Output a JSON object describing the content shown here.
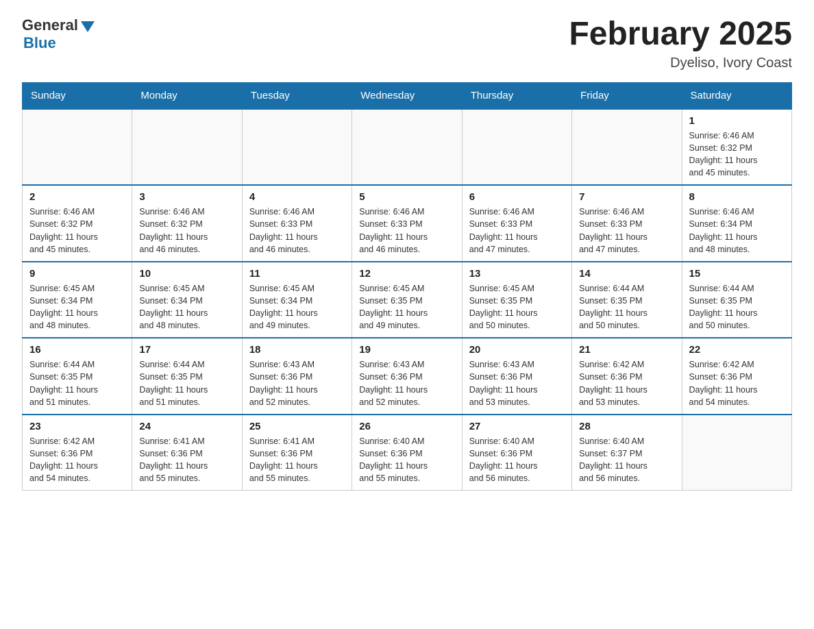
{
  "logo": {
    "general": "General",
    "blue": "Blue"
  },
  "title": "February 2025",
  "location": "Dyeliso, Ivory Coast",
  "days_of_week": [
    "Sunday",
    "Monday",
    "Tuesday",
    "Wednesday",
    "Thursday",
    "Friday",
    "Saturday"
  ],
  "weeks": [
    [
      {
        "day": "",
        "info": ""
      },
      {
        "day": "",
        "info": ""
      },
      {
        "day": "",
        "info": ""
      },
      {
        "day": "",
        "info": ""
      },
      {
        "day": "",
        "info": ""
      },
      {
        "day": "",
        "info": ""
      },
      {
        "day": "1",
        "info": "Sunrise: 6:46 AM\nSunset: 6:32 PM\nDaylight: 11 hours\nand 45 minutes."
      }
    ],
    [
      {
        "day": "2",
        "info": "Sunrise: 6:46 AM\nSunset: 6:32 PM\nDaylight: 11 hours\nand 45 minutes."
      },
      {
        "day": "3",
        "info": "Sunrise: 6:46 AM\nSunset: 6:32 PM\nDaylight: 11 hours\nand 46 minutes."
      },
      {
        "day": "4",
        "info": "Sunrise: 6:46 AM\nSunset: 6:33 PM\nDaylight: 11 hours\nand 46 minutes."
      },
      {
        "day": "5",
        "info": "Sunrise: 6:46 AM\nSunset: 6:33 PM\nDaylight: 11 hours\nand 46 minutes."
      },
      {
        "day": "6",
        "info": "Sunrise: 6:46 AM\nSunset: 6:33 PM\nDaylight: 11 hours\nand 47 minutes."
      },
      {
        "day": "7",
        "info": "Sunrise: 6:46 AM\nSunset: 6:33 PM\nDaylight: 11 hours\nand 47 minutes."
      },
      {
        "day": "8",
        "info": "Sunrise: 6:46 AM\nSunset: 6:34 PM\nDaylight: 11 hours\nand 48 minutes."
      }
    ],
    [
      {
        "day": "9",
        "info": "Sunrise: 6:45 AM\nSunset: 6:34 PM\nDaylight: 11 hours\nand 48 minutes."
      },
      {
        "day": "10",
        "info": "Sunrise: 6:45 AM\nSunset: 6:34 PM\nDaylight: 11 hours\nand 48 minutes."
      },
      {
        "day": "11",
        "info": "Sunrise: 6:45 AM\nSunset: 6:34 PM\nDaylight: 11 hours\nand 49 minutes."
      },
      {
        "day": "12",
        "info": "Sunrise: 6:45 AM\nSunset: 6:35 PM\nDaylight: 11 hours\nand 49 minutes."
      },
      {
        "day": "13",
        "info": "Sunrise: 6:45 AM\nSunset: 6:35 PM\nDaylight: 11 hours\nand 50 minutes."
      },
      {
        "day": "14",
        "info": "Sunrise: 6:44 AM\nSunset: 6:35 PM\nDaylight: 11 hours\nand 50 minutes."
      },
      {
        "day": "15",
        "info": "Sunrise: 6:44 AM\nSunset: 6:35 PM\nDaylight: 11 hours\nand 50 minutes."
      }
    ],
    [
      {
        "day": "16",
        "info": "Sunrise: 6:44 AM\nSunset: 6:35 PM\nDaylight: 11 hours\nand 51 minutes."
      },
      {
        "day": "17",
        "info": "Sunrise: 6:44 AM\nSunset: 6:35 PM\nDaylight: 11 hours\nand 51 minutes."
      },
      {
        "day": "18",
        "info": "Sunrise: 6:43 AM\nSunset: 6:36 PM\nDaylight: 11 hours\nand 52 minutes."
      },
      {
        "day": "19",
        "info": "Sunrise: 6:43 AM\nSunset: 6:36 PM\nDaylight: 11 hours\nand 52 minutes."
      },
      {
        "day": "20",
        "info": "Sunrise: 6:43 AM\nSunset: 6:36 PM\nDaylight: 11 hours\nand 53 minutes."
      },
      {
        "day": "21",
        "info": "Sunrise: 6:42 AM\nSunset: 6:36 PM\nDaylight: 11 hours\nand 53 minutes."
      },
      {
        "day": "22",
        "info": "Sunrise: 6:42 AM\nSunset: 6:36 PM\nDaylight: 11 hours\nand 54 minutes."
      }
    ],
    [
      {
        "day": "23",
        "info": "Sunrise: 6:42 AM\nSunset: 6:36 PM\nDaylight: 11 hours\nand 54 minutes."
      },
      {
        "day": "24",
        "info": "Sunrise: 6:41 AM\nSunset: 6:36 PM\nDaylight: 11 hours\nand 55 minutes."
      },
      {
        "day": "25",
        "info": "Sunrise: 6:41 AM\nSunset: 6:36 PM\nDaylight: 11 hours\nand 55 minutes."
      },
      {
        "day": "26",
        "info": "Sunrise: 6:40 AM\nSunset: 6:36 PM\nDaylight: 11 hours\nand 55 minutes."
      },
      {
        "day": "27",
        "info": "Sunrise: 6:40 AM\nSunset: 6:36 PM\nDaylight: 11 hours\nand 56 minutes."
      },
      {
        "day": "28",
        "info": "Sunrise: 6:40 AM\nSunset: 6:37 PM\nDaylight: 11 hours\nand 56 minutes."
      },
      {
        "day": "",
        "info": ""
      }
    ]
  ]
}
